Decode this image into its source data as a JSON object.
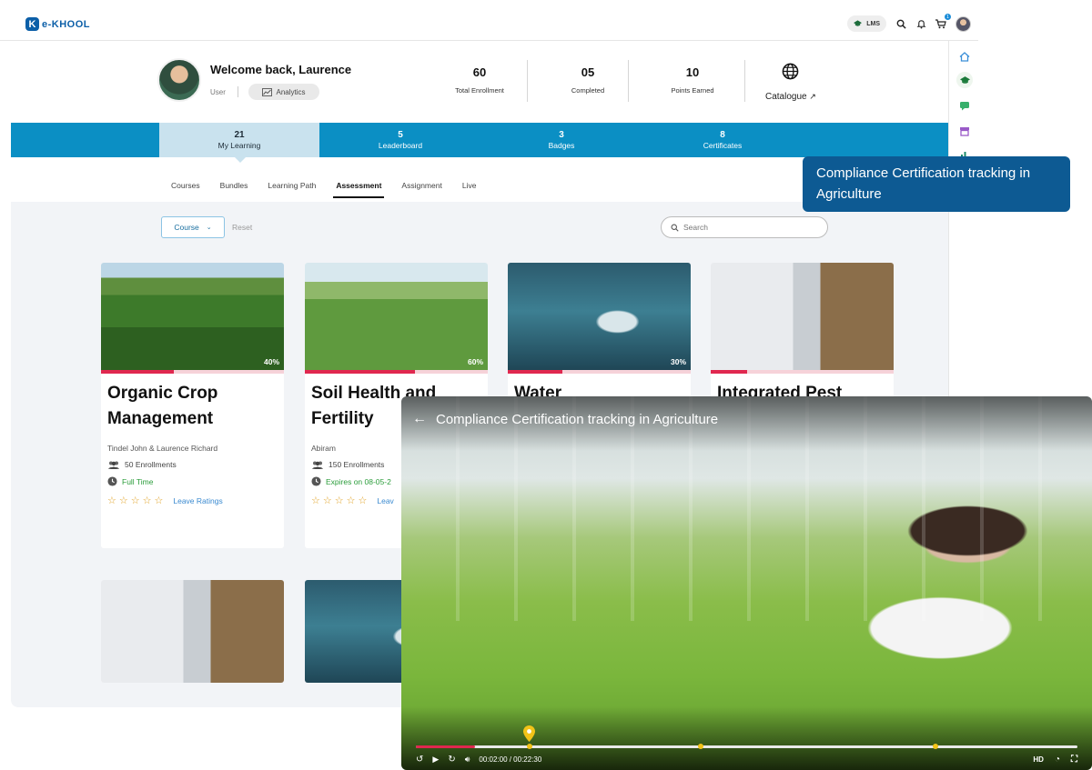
{
  "app": {
    "logo_mark": "K",
    "logo_text": "e-KHOOL"
  },
  "topbar": {
    "lms_label": "LMS",
    "cart_count": "1"
  },
  "profile": {
    "welcome": "Welcome back, Laurence",
    "role": "User",
    "analytics_label": "Analytics"
  },
  "stats": [
    {
      "value": "60",
      "label": "Total Enrollment"
    },
    {
      "value": "05",
      "label": "Completed"
    },
    {
      "value": "10",
      "label": "Points Earned"
    }
  ],
  "catalogue": {
    "label": "Catalogue"
  },
  "band_tabs": [
    {
      "value": "21",
      "label": "My Learning"
    },
    {
      "value": "5",
      "label": "Leaderboard"
    },
    {
      "value": "3",
      "label": "Badges"
    },
    {
      "value": "8",
      "label": "Certificates"
    }
  ],
  "sub_tabs": [
    "Courses",
    "Bundles",
    "Learning Path",
    "Assessment",
    "Assignment",
    "Live"
  ],
  "filters": {
    "course_label": "Course",
    "reset_label": "Reset",
    "search_placeholder": "Search"
  },
  "cards": [
    {
      "title": "Organic Crop Management",
      "progress_percent": 40,
      "progress_label": "40%",
      "author": "Tindel John & Laurence Richard",
      "enrollments": "50 Enrollments",
      "duration": "Full Time",
      "leave_ratings": "Leave Ratings"
    },
    {
      "title": "Soil Health and Fertility",
      "progress_percent": 60,
      "progress_label": "60%",
      "author": "Abiram",
      "enrollments": "150 Enrollments",
      "duration": "Expires on 08-05-2",
      "leave_ratings": "Leav"
    },
    {
      "title": "Water",
      "progress_percent": 30,
      "progress_label": "30%"
    },
    {
      "title": "Integrated Pest",
      "progress_percent": 20,
      "progress_label": ""
    }
  ],
  "tooltip": {
    "text": "Compliance Certification tracking in Agriculture"
  },
  "video": {
    "title": "Compliance Certification tracking in Agriculture",
    "time": "00:02:00 / 00:22:30",
    "quality": "HD",
    "played_fraction": 0.09
  },
  "colors": {
    "brand": "#0c5fa8",
    "band": "#0b8fc4",
    "band_active": "#c9e2ee",
    "progress": "#e0284f",
    "tooltip": "#0d5a93",
    "marker": "#f2c318"
  }
}
